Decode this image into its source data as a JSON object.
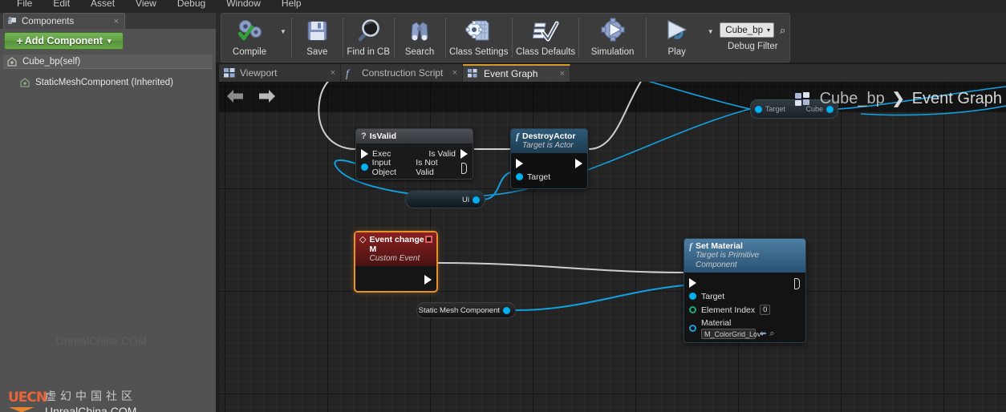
{
  "menubar": {
    "items": [
      "File",
      "Edit",
      "Asset",
      "View",
      "Debug",
      "Window",
      "Help"
    ]
  },
  "components_panel": {
    "tab": {
      "label": "Components",
      "icon": "components-icon",
      "close": "×"
    },
    "add_component": {
      "label": "Add Component",
      "plus": "+",
      "caret": "▾"
    },
    "tree": [
      {
        "label": "Cube_bp(self)",
        "icon": "component-icon",
        "selected": true
      },
      {
        "label": "StaticMeshComponent (Inherited)",
        "icon": "component-icon",
        "selected": false
      }
    ],
    "watermark": "UnrealChina.COM",
    "logo": {
      "mark": "UECN",
      "chinese": "虚幻中国社区",
      "english": "UnrealChina.COM"
    }
  },
  "toolbar": {
    "buttons": [
      {
        "label": "Compile",
        "icon": "compile-gear-check-icon",
        "has_caret": true
      },
      {
        "label": "Save",
        "icon": "floppy-disk-icon",
        "has_caret": false
      },
      {
        "label": "Find in CB",
        "icon": "magnifier-icon",
        "has_caret": false
      },
      {
        "label": "Search",
        "icon": "binoculars-icon",
        "has_caret": false
      },
      {
        "label": "Class Settings",
        "icon": "gear-document-icon",
        "has_caret": false
      },
      {
        "label": "Class Defaults",
        "icon": "checklist-icon",
        "has_caret": false
      },
      {
        "label": "Simulation",
        "icon": "gear-play-icon",
        "has_caret": false
      },
      {
        "label": "Play",
        "icon": "play-icon",
        "has_caret": true
      }
    ],
    "debug_filter": {
      "label": "Debug Filter",
      "value": "Cube_bp",
      "caret": "▾",
      "search_icon": "search-icon"
    }
  },
  "graph_tabs": [
    {
      "label": "Viewport",
      "icon": "viewport-icon",
      "active": false,
      "close": "×"
    },
    {
      "label": "Construction Script",
      "icon": "function-icon",
      "active": false,
      "close": "×"
    },
    {
      "label": "Event Graph",
      "icon": "eventgraph-icon",
      "active": true,
      "close": "×"
    }
  ],
  "graph": {
    "nav": {
      "back": "⬅",
      "forward": "➡"
    },
    "breadcrumb": {
      "icon": "eventgraph-icon",
      "root": "Cube_bp",
      "separator": "❯",
      "current": "Event Graph"
    },
    "nodes": {
      "ghost": {
        "pin_left": "Target",
        "pin_right": "Cube"
      },
      "isvalid": {
        "title": "IsValid",
        "glyph": "?",
        "inputs": [
          {
            "label": "Exec",
            "pin": "exec"
          },
          {
            "label": "Input Object",
            "pin": "object"
          }
        ],
        "outputs": [
          {
            "label": "Is Valid",
            "pin": "exec"
          },
          {
            "label": "Is Not Valid",
            "pin": "exec-hollow"
          }
        ]
      },
      "destroy_actor": {
        "title": "DestroyActor",
        "subtitle": "Target is Actor",
        "glyph": "f",
        "inputs": [
          {
            "label": "Target",
            "pin": "object"
          }
        ]
      },
      "ui_variable": {
        "label": "Ui"
      },
      "event_change_m": {
        "title": "Event change M",
        "subtitle": "Custom Event",
        "glyph": "◇"
      },
      "static_mesh_component": {
        "label": "Static Mesh Component"
      },
      "set_material": {
        "title": "Set Material",
        "subtitle": "Target is Primitive Component",
        "glyph": "f",
        "pins": [
          {
            "label": "Target",
            "pin": "object",
            "value": null
          },
          {
            "label": "Element Index",
            "pin": "int",
            "value": "0"
          },
          {
            "label": "Material",
            "pin": "object-o",
            "value": "M_ColorGrid_Lov",
            "caret": "▾",
            "arrow": "⬅",
            "search": "⌕"
          }
        ]
      }
    }
  },
  "colors": {
    "accent_green": "#63a046",
    "exec_wire": "#cfcfcf",
    "data_wire": "#12a0e0",
    "event_border": "#e8912a",
    "function_header": "#2a5272",
    "logo_orange": "#e8832f"
  }
}
